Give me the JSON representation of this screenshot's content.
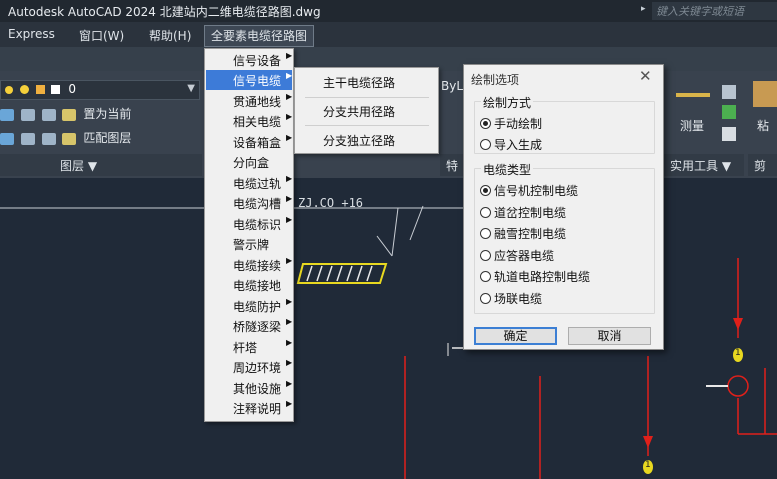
{
  "titlebar": {
    "title": "Autodesk AutoCAD 2024    北建站内二维电缆径路图.dwg",
    "search_placeholder": "键入关键字或短语"
  },
  "menubar": {
    "items": [
      "Express",
      "窗口(W)",
      "帮助(H)",
      "全要素电缆径路图"
    ]
  },
  "ribbon": {
    "layer_value": "0",
    "set_current": "置为当前",
    "match_layer": "匹配图层",
    "layers_panel": "图层 ▼",
    "special_panel_partial": "特",
    "bylayer_partial": "ByLa",
    "measure": "测量",
    "utilities_panel": "实用工具 ▼",
    "paste_partial": "粘",
    "clip_partial": "剪"
  },
  "menu_main": {
    "items": [
      {
        "label": "信号设备",
        "submenu": true
      },
      {
        "label": "信号电缆",
        "submenu": true
      },
      {
        "label": "贯通地线",
        "submenu": true
      },
      {
        "label": "相关电缆",
        "submenu": true
      },
      {
        "label": "设备箱盒",
        "submenu": true
      },
      {
        "label": "分向盒",
        "submenu": false
      },
      {
        "label": "电缆过轨",
        "submenu": true
      },
      {
        "label": "电缆沟槽",
        "submenu": true
      },
      {
        "label": "电缆标识",
        "submenu": true
      },
      {
        "label": "警示牌",
        "submenu": false
      },
      {
        "label": "电缆接续",
        "submenu": true
      },
      {
        "label": "电缆接地",
        "submenu": false
      },
      {
        "label": "电缆防护",
        "submenu": true
      },
      {
        "label": "桥隧逐梁",
        "submenu": true
      },
      {
        "label": "杆塔",
        "submenu": true
      },
      {
        "label": "周边环境",
        "submenu": true
      },
      {
        "label": "其他设施",
        "submenu": true
      },
      {
        "label": "注释说明",
        "submenu": true
      }
    ],
    "highlighted_index": 1
  },
  "menu_sub": {
    "items": [
      "主干电缆径路",
      "分支共用径路",
      "分支独立径路"
    ]
  },
  "dialog": {
    "title": "绘制选项",
    "group_draw_mode": "绘制方式",
    "draw_modes": [
      {
        "label": "手动绘制",
        "checked": true
      },
      {
        "label": "导入生成",
        "checked": false
      }
    ],
    "group_cable_type": "电缆类型",
    "cable_types": [
      {
        "label": "信号机控制电缆",
        "checked": true
      },
      {
        "label": "道岔控制电缆",
        "checked": false
      },
      {
        "label": "融雪控制电缆",
        "checked": false
      },
      {
        "label": "应答器电缆",
        "checked": false
      },
      {
        "label": "轨道电路控制电缆",
        "checked": false
      },
      {
        "label": "场联电缆",
        "checked": false
      }
    ],
    "ok": "确定",
    "cancel": "取消"
  },
  "drawing": {
    "partial_text": "ZJ.CO  +16",
    "marker_1": "1",
    "marker_2": "1"
  },
  "colors": {
    "highlight": "#3d7bd8",
    "cad_red": "#e0201a",
    "cad_yellow": "#f0e000"
  }
}
